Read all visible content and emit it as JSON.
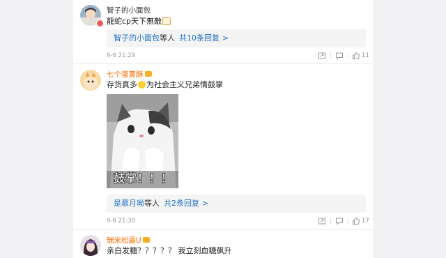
{
  "comments": [
    {
      "user": "智子的小面包",
      "text_before": "龍蛇cp天下無敵",
      "reply": {
        "who": "智子的小面包",
        "suffix": "等人",
        "count": "共10条回复",
        "arrow": ">"
      },
      "time": "9-6 21:29",
      "likes": "11"
    },
    {
      "user": "七个蛋黄酥",
      "text_before": "存货真多",
      "text_after": "为社会主义兄弟情鼓掌",
      "image_caption": "鼓掌！！！",
      "reply": {
        "who": "是慕月呦",
        "suffix": "等人",
        "count": "共2条回复",
        "arrow": ">"
      },
      "time": "9-6 21:30",
      "likes": "17"
    },
    {
      "user": "瑞米松露U",
      "text_before": "亲白发糖？？？？？ 我立刻血糖飙升"
    }
  ],
  "icons": {
    "share": "share-icon",
    "comment": "comment-icon",
    "like": "thumbs-up-icon"
  },
  "colors": {
    "link_blue": "#1f6fc4",
    "vip_orange": "#f86d00",
    "background": "#f2f2f5"
  }
}
